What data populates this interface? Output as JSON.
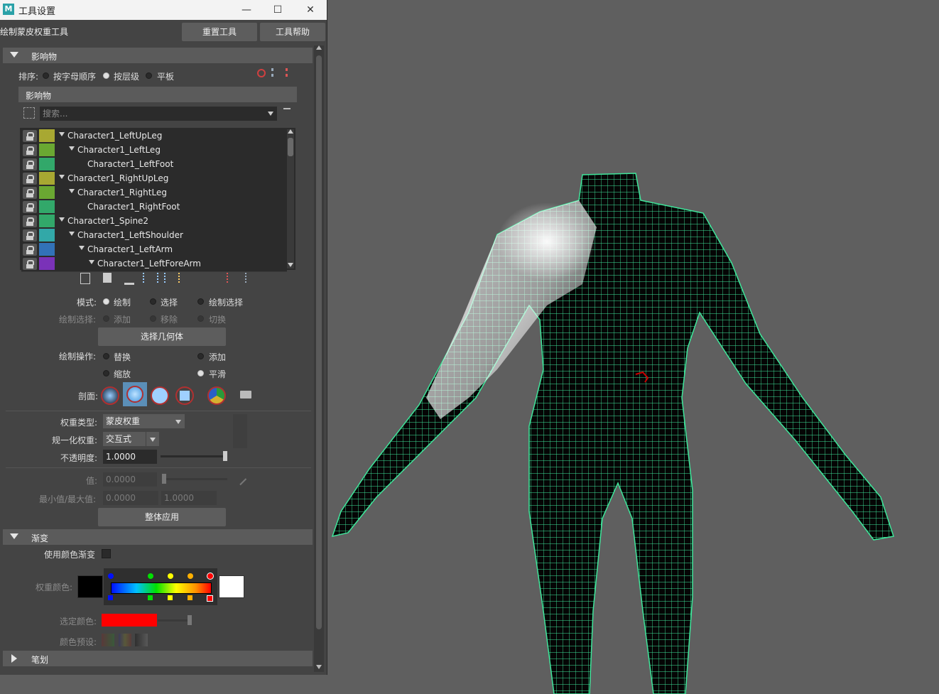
{
  "window": {
    "app_icon": "M",
    "title": "工具设置",
    "minimize": "—",
    "maximize": "☐",
    "close": "✕"
  },
  "tool": {
    "name": "绘制蒙皮权重工具",
    "reset_label": "重置工具",
    "help_label": "工具帮助"
  },
  "influences": {
    "section_title": "影响物",
    "sort_label": "排序:",
    "sort_options": [
      "按字母顺序",
      "按层级",
      "平板"
    ],
    "sort_selected": "按层级",
    "list_header": "影响物",
    "search_placeholder": "搜索...",
    "items": [
      {
        "name": "Character1_LeftUpLeg",
        "color": "#a8a832",
        "expanded": true
      },
      {
        "name": "Character1_LeftLeg",
        "color": "#6aa832",
        "expanded": true
      },
      {
        "name": "Character1_LeftFoot",
        "color": "#32a86a",
        "expanded": false
      },
      {
        "name": "Character1_RightUpLeg",
        "color": "#a8a832",
        "expanded": true
      },
      {
        "name": "Character1_RightLeg",
        "color": "#6aa832",
        "expanded": true
      },
      {
        "name": "Character1_RightFoot",
        "color": "#32a86a",
        "expanded": false
      },
      {
        "name": "Character1_Spine2",
        "color": "#32a86a",
        "expanded": true
      },
      {
        "name": "Character1_LeftShoulder",
        "color": "#32a8a8",
        "expanded": true
      },
      {
        "name": "Character1_LeftArm",
        "color": "#3272b8",
        "expanded": true
      },
      {
        "name": "Character1_LeftForeArm",
        "color": "#7a32b8",
        "expanded": true
      }
    ]
  },
  "mode": {
    "label": "模式:",
    "options": [
      "绘制",
      "选择",
      "绘制选择"
    ],
    "selected": "绘制",
    "paint_select_label": "绘制选择:",
    "paint_select_options": [
      "添加",
      "移除",
      "切换"
    ],
    "select_geometry_label": "选择几何体",
    "paint_op_label": "绘制操作:",
    "paint_ops": [
      "替换",
      "添加",
      "缩放",
      "平滑"
    ],
    "paint_op_selected": "平滑",
    "profile_label": "剖面:"
  },
  "weights": {
    "weight_type_label": "权重类型:",
    "weight_type_value": "蒙皮权重",
    "normalize_label": "规一化权重:",
    "normalize_value": "交互式",
    "opacity_label": "不透明度:",
    "opacity_value": "1.0000",
    "opacity_level": 1.0,
    "value_label": "值:",
    "value_value": "0.0000",
    "minmax_label": "最小值/最大值:",
    "min_value": "0.0000",
    "max_value": "1.0000",
    "flood_label": "整体应用"
  },
  "gradient": {
    "section_title": "渐变",
    "use_color_ramp_label": "使用颜色渐变",
    "weight_color_label": "权重颜色:",
    "select_color_label": "选定颜色:",
    "select_color": "#ff0000",
    "color_presets_label": "颜色预设:"
  },
  "stroke": {
    "section_title": "笔划"
  }
}
